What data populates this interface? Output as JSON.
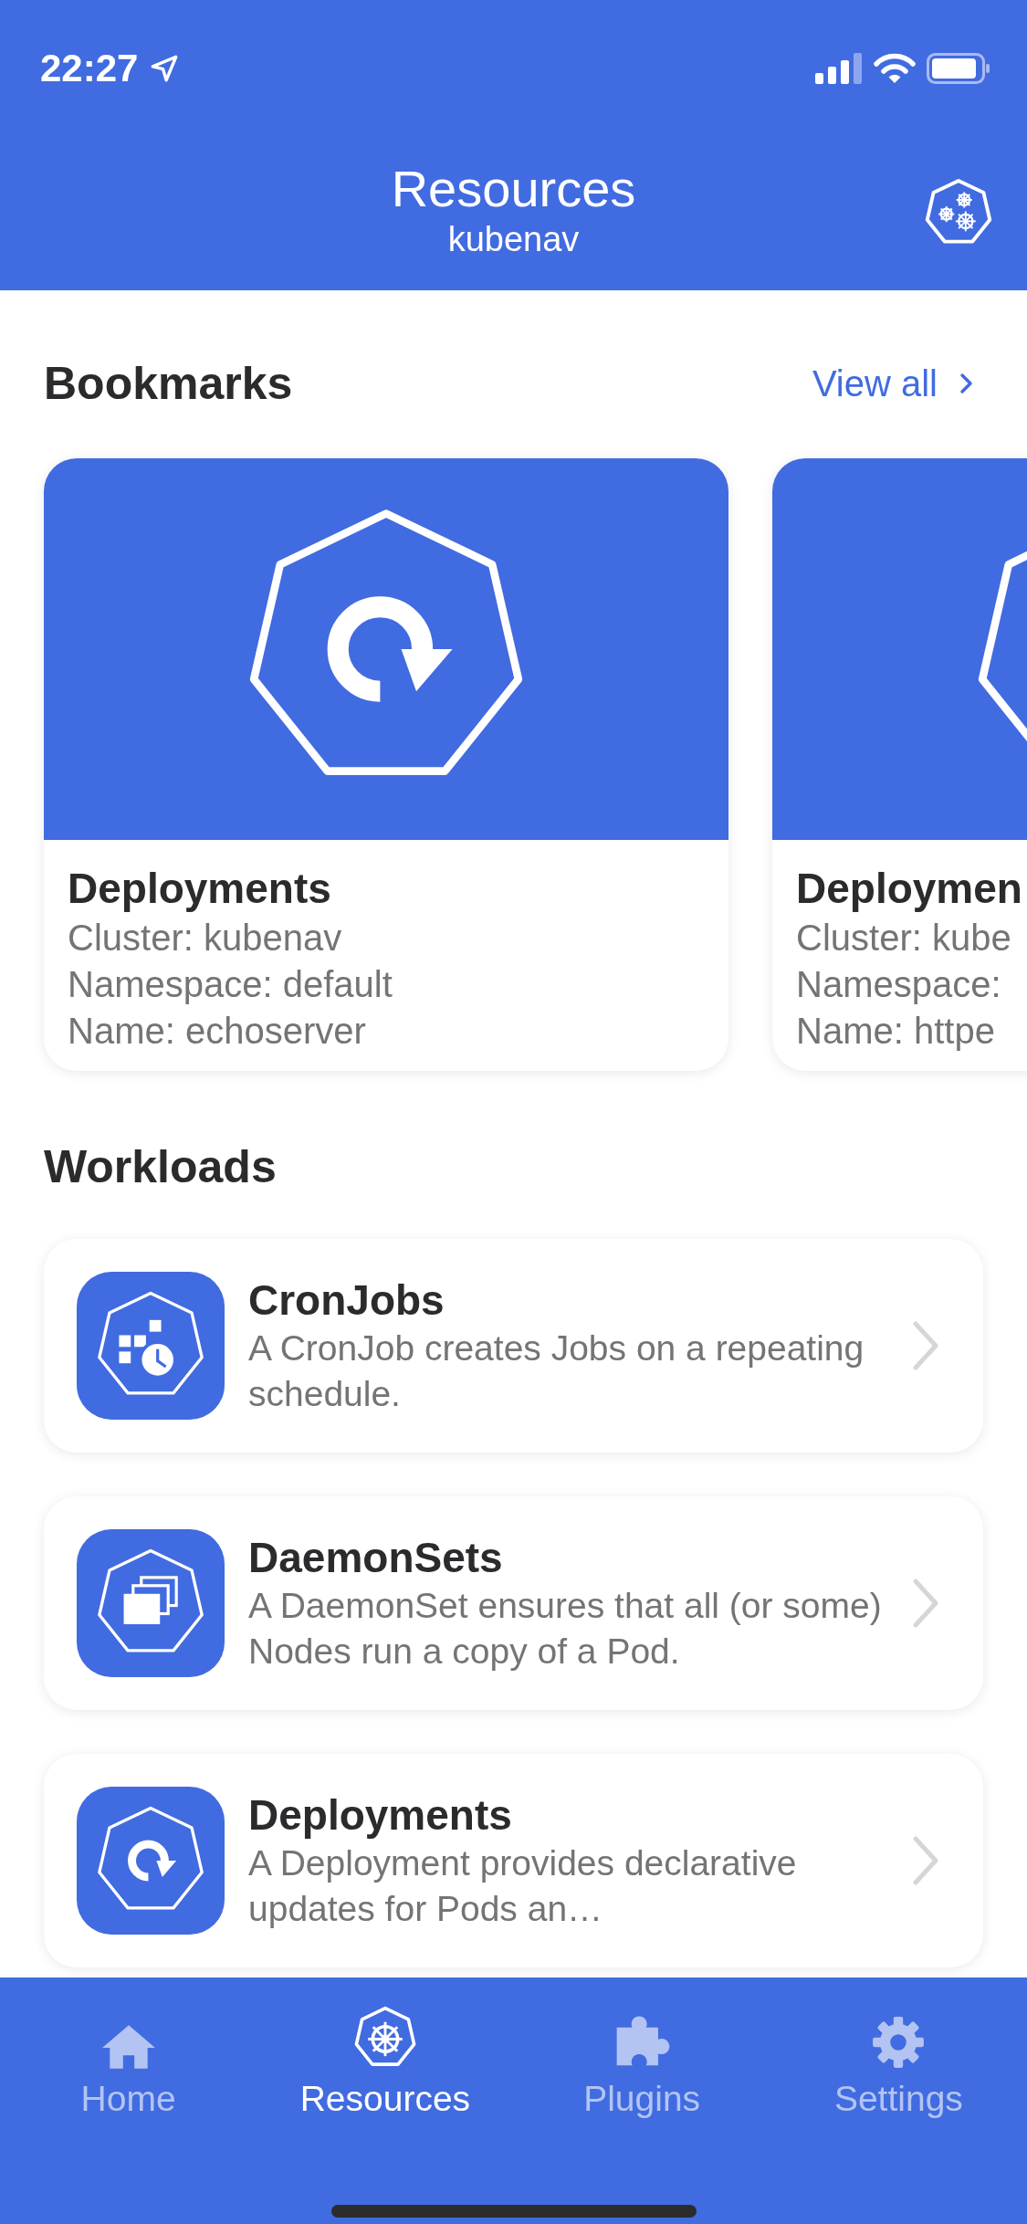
{
  "status_bar": {
    "time": "22:27"
  },
  "header": {
    "title": "Resources",
    "subtitle": "kubenav"
  },
  "bookmarks": {
    "title": "Bookmarks",
    "view_all": "View all",
    "cards": [
      {
        "kind": "deployment",
        "title": "Deployments",
        "lines": [
          "Cluster: kubenav",
          "Namespace: default",
          "Name: echoserver"
        ]
      },
      {
        "kind": "deployment",
        "title": "Deploymen",
        "lines": [
          "Cluster: kube",
          "Namespace:",
          "Name: httpe"
        ]
      }
    ]
  },
  "workloads": {
    "title": "Workloads",
    "items": [
      {
        "kind": "cronjob",
        "title": "CronJobs",
        "description": "A CronJob creates Jobs on a repeating schedule."
      },
      {
        "kind": "daemonset",
        "title": "DaemonSets",
        "description": "A DaemonSet ensures that all (or some) Nodes run a copy of a Pod."
      },
      {
        "kind": "deployment",
        "title": "Deployments",
        "description": "A Deployment provides declarative updates for Pods an…"
      }
    ]
  },
  "tabs": [
    {
      "kind": "home",
      "label": "Home",
      "selected": false
    },
    {
      "kind": "resources",
      "label": "Resources",
      "selected": true
    },
    {
      "kind": "plugins",
      "label": "Plugins",
      "selected": false
    },
    {
      "kind": "settings",
      "label": "Settings",
      "selected": false
    }
  ]
}
